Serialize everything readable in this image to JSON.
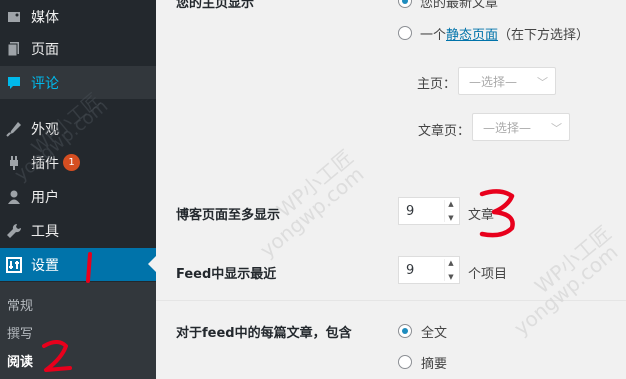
{
  "sidebar": {
    "items": [
      {
        "label": "媒体",
        "icon": "media-icon"
      },
      {
        "label": "页面",
        "icon": "pages-icon"
      },
      {
        "label": "评论",
        "icon": "comments-icon"
      },
      {
        "label": "外观",
        "icon": "appearance-icon"
      },
      {
        "label": "插件",
        "icon": "plugins-icon",
        "badge": "1"
      },
      {
        "label": "用户",
        "icon": "users-icon"
      },
      {
        "label": "工具",
        "icon": "tools-icon"
      },
      {
        "label": "设置",
        "icon": "settings-icon"
      }
    ],
    "submenu": [
      {
        "label": "常规"
      },
      {
        "label": "撰写"
      },
      {
        "label": "阅读"
      }
    ]
  },
  "homepage": {
    "option_posts": "您的最新文章",
    "option_static_prefix": "一个",
    "option_static_link": "静态页面",
    "option_static_suffix": "（在下方选择）",
    "front_label": "主页：",
    "front_select": "—选择—",
    "posts_label": "文章页：",
    "posts_select": "—选择—"
  },
  "posts_per_page": {
    "label": "博客页面至多显示",
    "value": "9",
    "unit": "文章"
  },
  "feed_count": {
    "label": "Feed中显示最近",
    "value": "9",
    "unit": "个项目"
  },
  "feed_content": {
    "label": "对于feed中的每篇文章，包含",
    "option_full": "全文",
    "option_summary": "摘要"
  },
  "watermark": {
    "text_cn": "WP小工匠",
    "text_en": "yongwp.com"
  },
  "annotations": [
    "1",
    "2",
    "3"
  ],
  "colors": {
    "sidebar_bg": "#23282d",
    "active_blue": "#0073aa",
    "annotation_red": "#e8001c"
  }
}
